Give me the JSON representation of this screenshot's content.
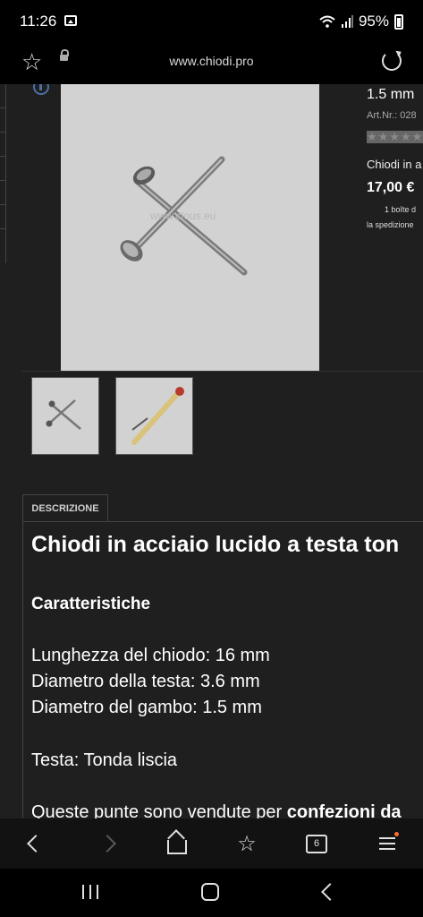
{
  "status_bar": {
    "time": "11:26",
    "battery": "95%"
  },
  "browser": {
    "url": "www.chiodi.pro",
    "tab_count": "6"
  },
  "product": {
    "size": "1.5 mm",
    "art_nr": "Art.Nr.: 028",
    "name": "Chiodi in a",
    "price": "17,00 €",
    "box_note": "1 boîte d",
    "shipping_note": "la spedizione",
    "watermark": "www.clous.eu"
  },
  "description": {
    "tab_label": "DESCRIZIONE",
    "title": "Chiodi in acciaio lucido a testa ton",
    "section_heading": "Caratteristiche",
    "specs": [
      "Lunghezza del chiodo: 16 mm",
      "Diametro della testa: 3.6 mm",
      "Diametro del gambo: 1.5 mm"
    ],
    "head_type": "Testa: Tonda liscia",
    "sold_in_prefix": "Queste punte sono vendute per ",
    "sold_in_bold": "confezioni da"
  },
  "colors": {
    "background": "#1f1f1f",
    "bars": "#000000",
    "menu_badge": "#ff6b2c"
  }
}
